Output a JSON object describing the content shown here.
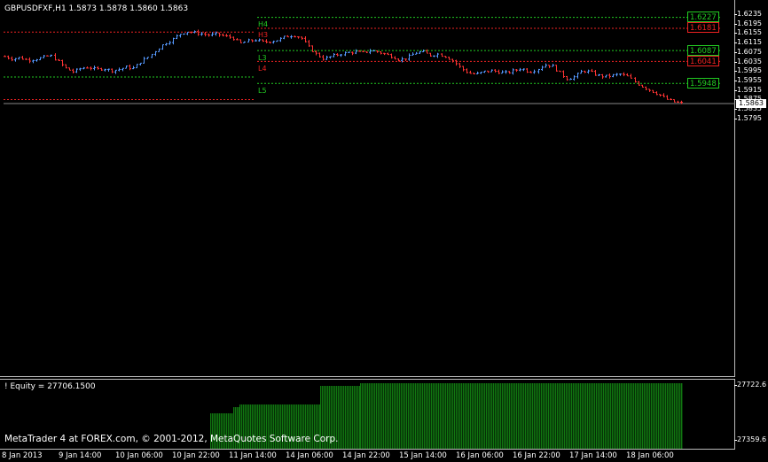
{
  "window": {
    "symbol_title": "GBPUSDFXF,H1  1.5873 1.5878 1.5860 1.5863",
    "copyright": "MetaTrader 4 at FOREX.com, © 2001-2012, MetaQuotes Software Corp."
  },
  "colors": {
    "background": "#000000",
    "bull_candle": "#5599ff",
    "bear_candle": "#ff3333",
    "support_level": "#22cc22",
    "resistance_level": "#ee2222",
    "equity_bars": "#117711",
    "axis": "#bbbbbb"
  },
  "price_axis": {
    "ticks": [
      "1.6235",
      "1.6195",
      "1.6155",
      "1.6115",
      "1.6075",
      "1.6035",
      "1.5995",
      "1.5955",
      "1.5915",
      "1.5875",
      "1.5835",
      "1.5795"
    ],
    "current_price": "1.5863"
  },
  "equity_axis": {
    "ticks": [
      "27722.6",
      "27359.6"
    ]
  },
  "equity_panel": {
    "label": "! Equity = 27706.1500"
  },
  "time_axis": {
    "ticks": [
      "8 Jan 2013",
      "9 Jan 14:00",
      "10 Jan 06:00",
      "10 Jan 22:00",
      "11 Jan 14:00",
      "14 Jan 06:00",
      "14 Jan 22:00",
      "15 Jan 14:00",
      "16 Jan 06:00",
      "16 Jan 22:00",
      "17 Jan 14:00",
      "18 Jan 06:00"
    ]
  },
  "pivot_levels": [
    {
      "tag": "H4",
      "value": "1.6227",
      "type": "support"
    },
    {
      "tag": "H3",
      "value": "1.6181",
      "type": "resistance"
    },
    {
      "tag": "L3",
      "value": "1.6087",
      "type": "support"
    },
    {
      "tag": "L4",
      "value": "1.6041",
      "type": "resistance"
    },
    {
      "tag": "L5",
      "value": "1.5948",
      "type": "support"
    }
  ],
  "previous_levels": [
    {
      "value": 1.6165,
      "type": "resistance"
    },
    {
      "value": 1.5975,
      "type": "support"
    },
    {
      "value": 1.588,
      "type": "resistance"
    }
  ],
  "chart_data": {
    "type": "candlestick",
    "timeframe": "H1",
    "close_path": [
      1.606,
      1.605,
      1.6055,
      1.6045,
      1.6048,
      1.6055,
      1.6065,
      1.604,
      1.601,
      1.5995,
      1.601,
      1.6015,
      1.6005,
      1.601,
      1.6,
      1.6005,
      1.6015,
      1.601,
      1.604,
      1.606,
      1.609,
      1.6115,
      1.613,
      1.6155,
      1.6165,
      1.616,
      1.6155,
      1.615,
      1.6155,
      1.6145,
      1.614,
      1.6115,
      1.6125,
      1.613,
      1.612,
      1.6125,
      1.613,
      1.6145,
      1.615,
      1.614,
      1.61,
      1.607,
      1.605,
      1.606,
      1.607,
      1.6075,
      1.608,
      1.6075,
      1.6085,
      1.608,
      1.607,
      1.606,
      1.6045,
      1.6055,
      1.6075,
      1.608,
      1.6065,
      1.607,
      1.606,
      1.604,
      1.601,
      1.599,
      1.5985,
      1.5995,
      1.6,
      1.5995,
      1.599,
      1.6,
      1.601,
      1.5995,
      1.6005,
      1.6025,
      1.602,
      1.599,
      1.5965,
      1.5975,
      1.6,
      1.5995,
      1.598,
      1.5975,
      1.598,
      1.5985,
      1.5975,
      1.595,
      1.593,
      1.5915,
      1.59,
      1.588,
      1.5868,
      1.5863
    ]
  }
}
